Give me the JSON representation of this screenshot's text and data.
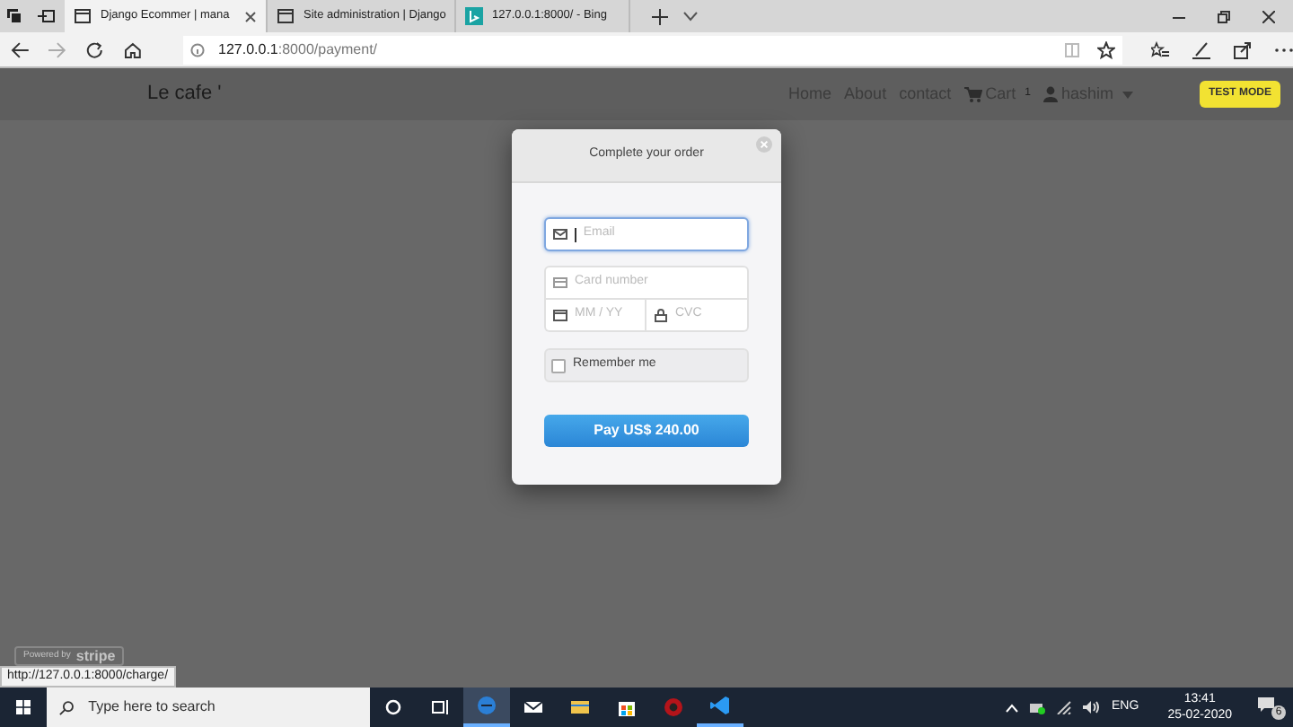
{
  "browser": {
    "tabs": [
      {
        "title": "Django Ecommer | mana",
        "selected": true,
        "kind": "page"
      },
      {
        "title": "Site administration | Django",
        "selected": false,
        "kind": "page"
      },
      {
        "title": "127.0.0.1:8000/ - Bing",
        "selected": false,
        "kind": "bing"
      }
    ],
    "address": {
      "host": "127.0.0.1",
      "rest": ":8000/payment/"
    },
    "status_url": "http://127.0.0.1:8000/charge/"
  },
  "site": {
    "brand": "Le cafe '",
    "nav": [
      {
        "label": "Home",
        "kind": "link"
      },
      {
        "label": "About",
        "kind": "link"
      },
      {
        "label": "contact",
        "kind": "link"
      },
      {
        "label": "Cart",
        "kind": "cart",
        "count": "1"
      },
      {
        "label": "hashim",
        "kind": "user"
      }
    ],
    "test_mode": "TEST MODE",
    "powered": "Powered by",
    "stripe": "stripe"
  },
  "modal": {
    "title": "Complete your order",
    "fields": [
      {
        "placeholder": "Email",
        "kind": "email",
        "focused": true
      },
      {
        "placeholder": "Card number",
        "kind": "card",
        "focused": false
      },
      {
        "placeholder": "MM / YY",
        "kind": "date",
        "focused": false
      },
      {
        "placeholder": "CVC",
        "kind": "cvc",
        "focused": false
      }
    ],
    "remember": {
      "label": "Remember me",
      "checked": false
    },
    "pay": "Pay US$ 240.00"
  },
  "taskbar": {
    "search_placeholder": "Type here to search",
    "lang": "ENG",
    "time": "13:41",
    "date": "25-02-2020",
    "notifications": "6"
  }
}
